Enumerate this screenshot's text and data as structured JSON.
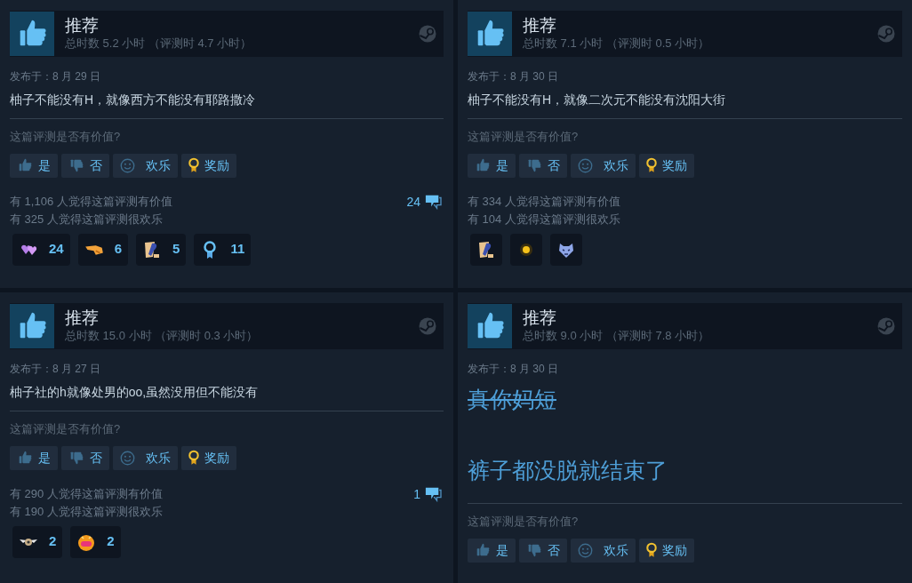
{
  "reviews": [
    {
      "verdict": "推荐",
      "hours": "总时数 5.2 小时 （评测时 4.7 小时）",
      "posted": "发布于：8 月 29 日",
      "body": [
        {
          "text": "柚子不能没有H，就像西方不能没有耶路撒冷",
          "kind": "plain"
        }
      ],
      "question": "这篇评测是否有价值?",
      "buttons": [
        {
          "label": "是",
          "kind": "yes"
        },
        {
          "label": "否",
          "kind": "no"
        },
        {
          "label": "欢乐",
          "kind": "funny"
        },
        {
          "label": "奖励",
          "kind": "award"
        }
      ],
      "helpful": [
        "有 1,106 人觉得这篇评测有价值",
        "有 325 人觉得这篇评测很欢乐"
      ],
      "comments": "24",
      "awards": [
        {
          "kind": "hearts",
          "count": "24"
        },
        {
          "kind": "hand",
          "count": "6"
        },
        {
          "kind": "scroll",
          "count": "5"
        },
        {
          "kind": "medal",
          "count": "11"
        }
      ]
    },
    {
      "verdict": "推荐",
      "hours": "总时数 7.1 小时 （评测时 0.5 小时）",
      "posted": "发布于：8 月 30 日",
      "body": [
        {
          "text": "柚子不能没有H，就像二次元不能没有沈阳大街",
          "kind": "plain"
        }
      ],
      "question": "这篇评测是否有价值?",
      "buttons": [
        {
          "label": "是",
          "kind": "yes"
        },
        {
          "label": "否",
          "kind": "no"
        },
        {
          "label": "欢乐",
          "kind": "funny"
        },
        {
          "label": "奖励",
          "kind": "award"
        }
      ],
      "helpful": [
        "有 334 人觉得这篇评测有价值",
        "有 104 人觉得这篇评测很欢乐"
      ],
      "awards": [
        {
          "kind": "scroll"
        },
        {
          "kind": "sun"
        },
        {
          "kind": "tiger"
        }
      ]
    },
    {
      "verdict": "推荐",
      "hours": "总时数 15.0 小时 （评测时 0.3 小时）",
      "posted": "发布于：8 月 27 日",
      "body": [
        {
          "text": "柚子社的h就像处男的oo,虽然没用但不能没有",
          "kind": "plain"
        }
      ],
      "question": "这篇评测是否有价值?",
      "buttons": [
        {
          "label": "是",
          "kind": "yes"
        },
        {
          "label": "否",
          "kind": "no"
        },
        {
          "label": "欢乐",
          "kind": "funny"
        },
        {
          "label": "奖励",
          "kind": "award"
        }
      ],
      "helpful": [
        "有 290 人觉得这篇评测有价值",
        "有 190 人觉得这篇评测很欢乐"
      ],
      "comments": "1",
      "awards": [
        {
          "kind": "wings",
          "count": "2"
        },
        {
          "kind": "face",
          "count": "2"
        }
      ]
    },
    {
      "verdict": "推荐",
      "hours": "总时数 9.0 小时 （评测时 7.8 小时）",
      "posted": "发布于：8 月 30 日",
      "body": [
        {
          "text": "真你妈短",
          "kind": "struck"
        },
        {
          "text": "裤子都没脱就结束了",
          "kind": "heading"
        }
      ],
      "question": "这篇评测是否有价值?",
      "buttons": [
        {
          "label": "是",
          "kind": "yes"
        },
        {
          "label": "否",
          "kind": "no"
        },
        {
          "label": "欢乐",
          "kind": "funny"
        },
        {
          "label": "奖励",
          "kind": "award"
        }
      ]
    }
  ]
}
